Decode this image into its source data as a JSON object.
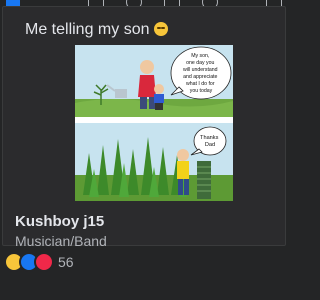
{
  "post": {
    "caption": "Me telling my son"
  },
  "comic": {
    "panel1_bubble": [
      "My son,",
      "one day you",
      "will understand",
      "and appreciate",
      "what I do for",
      "you today"
    ],
    "panel2_bubble": [
      "Thanks",
      "Dad"
    ]
  },
  "page": {
    "name": "Kushboy j15",
    "category": "Musician/Band"
  },
  "reactions": {
    "types": [
      "haha-icon",
      "like-icon",
      "love-icon"
    ],
    "count": "56"
  },
  "colors": {
    "background": "#242526",
    "like": "#1877f2",
    "love": "#f02849",
    "haha": "#f7c53a"
  }
}
